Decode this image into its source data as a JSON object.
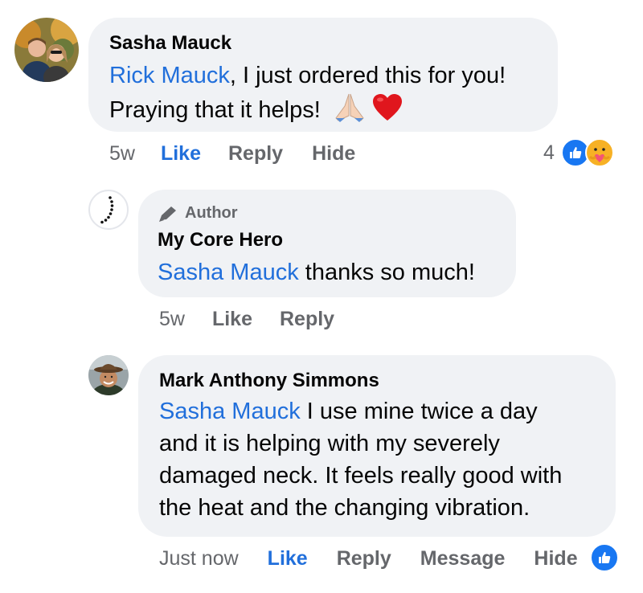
{
  "comments": [
    {
      "author": "Sasha Mauck",
      "mention": "Rick Mauck",
      "text_line1_rest": ", I just ordered this for you!",
      "text_line2": "Praying that it helps!",
      "time": "5w",
      "like_label": "Like",
      "reply_label": "Reply",
      "hide_label": "Hide",
      "reaction_count": "4",
      "reactions": [
        "like-icon",
        "care-icon"
      ]
    },
    {
      "badge": "Author",
      "author": "My Core Hero",
      "mention": "Sasha Mauck",
      "text_rest": " thanks so much!",
      "time": "5w",
      "like_label": "Like",
      "reply_label": "Reply"
    },
    {
      "author": "Mark Anthony Simmons",
      "mention": "Sasha Mauck",
      "text_line1_rest": " I use mine twice a day",
      "text_line2": "and it is helping with my severely",
      "text_line3": "damaged neck. It feels really good with",
      "text_line4": "the heat and the changing vibration.",
      "time": "Just now",
      "like_label": "Like",
      "reply_label": "Reply",
      "message_label": "Message",
      "hide_label": "Hide",
      "reactions": [
        "like-icon"
      ]
    }
  ],
  "colors": {
    "bubble": "#f0f2f5",
    "mention": "#216fdb",
    "muted": "#65676b",
    "like_blue": "#1877f2"
  }
}
